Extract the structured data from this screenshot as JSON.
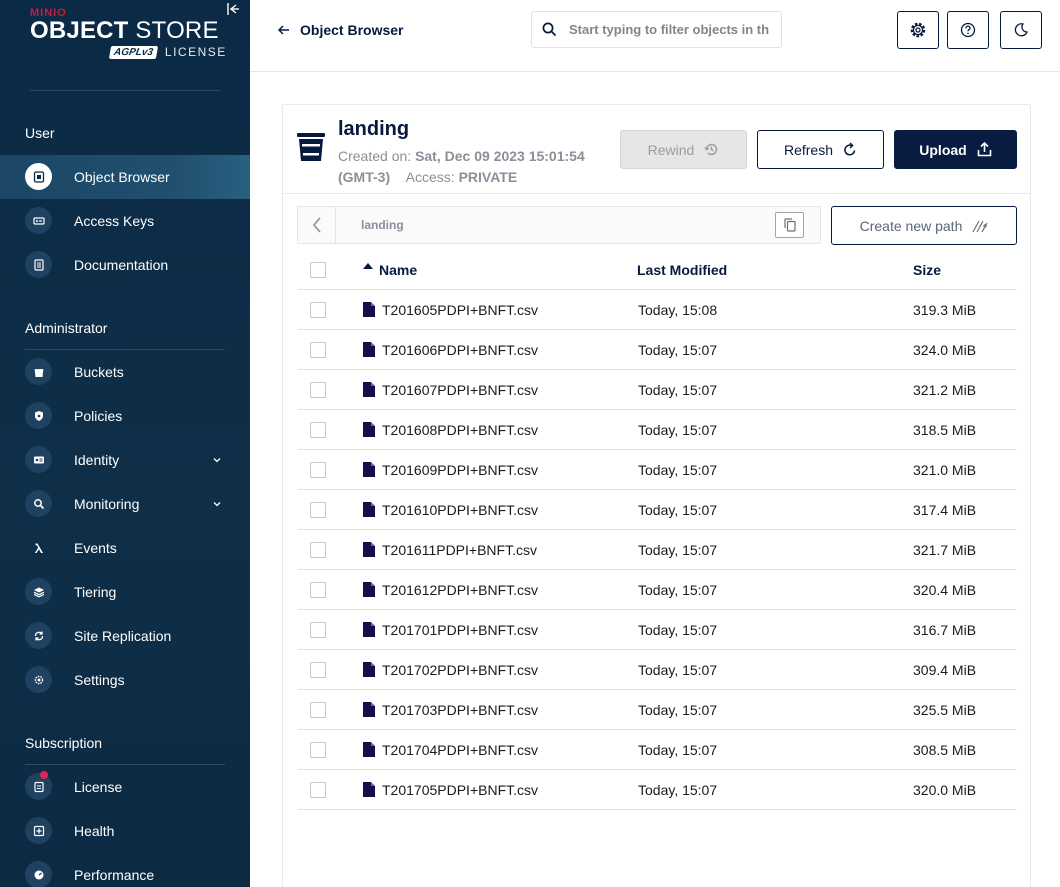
{
  "sidebar": {
    "logo": {
      "brand": "MINIO",
      "title_bold": "OBJECT",
      "title_rest": " STORE",
      "agpl": "AGPLv3",
      "license": "LICENSE"
    },
    "sections": [
      {
        "title": "User"
      },
      {
        "title": "Administrator"
      },
      {
        "title": "Subscription"
      }
    ],
    "items": [
      {
        "label": "Object Browser",
        "icon": "object-browser-icon"
      },
      {
        "label": "Access Keys",
        "icon": "key-icon"
      },
      {
        "label": "Documentation",
        "icon": "document-icon"
      },
      {
        "label": "Buckets",
        "icon": "bucket-icon"
      },
      {
        "label": "Policies",
        "icon": "shield-icon"
      },
      {
        "label": "Identity",
        "icon": "identity-icon"
      },
      {
        "label": "Monitoring",
        "icon": "magnifier-icon"
      },
      {
        "label": "Events",
        "icon": "lambda-icon"
      },
      {
        "label": "Tiering",
        "icon": "layers-icon"
      },
      {
        "label": "Site Replication",
        "icon": "sync-icon"
      },
      {
        "label": "Settings",
        "icon": "gear-icon"
      },
      {
        "label": "License",
        "icon": "license-icon"
      },
      {
        "label": "Health",
        "icon": "health-icon"
      },
      {
        "label": "Performance",
        "icon": "performance-icon"
      }
    ]
  },
  "header": {
    "back_label": "Object Browser",
    "search_placeholder": "Start typing to filter objects in the bucket"
  },
  "bucket": {
    "name": "landing",
    "created_label": "Created on:",
    "created_value": "Sat, Dec 09 2023 15:01:54 (GMT-3)",
    "access_label": "Access:",
    "access_value": "PRIVATE"
  },
  "actions": {
    "rewind": "Rewind",
    "refresh": "Refresh",
    "upload": "Upload",
    "create_path": "Create new path"
  },
  "breadcrumb": {
    "path": "landing"
  },
  "table": {
    "columns": {
      "name": "Name",
      "modified": "Last Modified",
      "size": "Size"
    },
    "rows": [
      {
        "name": "T201605PDPI+BNFT.csv",
        "modified": "Today, 15:08",
        "size": "319.3 MiB"
      },
      {
        "name": "T201606PDPI+BNFT.csv",
        "modified": "Today, 15:07",
        "size": "324.0 MiB"
      },
      {
        "name": "T201607PDPI+BNFT.csv",
        "modified": "Today, 15:07",
        "size": "321.2 MiB"
      },
      {
        "name": "T201608PDPI+BNFT.csv",
        "modified": "Today, 15:07",
        "size": "318.5 MiB"
      },
      {
        "name": "T201609PDPI+BNFT.csv",
        "modified": "Today, 15:07",
        "size": "321.0 MiB"
      },
      {
        "name": "T201610PDPI+BNFT.csv",
        "modified": "Today, 15:07",
        "size": "317.4 MiB"
      },
      {
        "name": "T201611PDPI+BNFT.csv",
        "modified": "Today, 15:07",
        "size": "321.7 MiB"
      },
      {
        "name": "T201612PDPI+BNFT.csv",
        "modified": "Today, 15:07",
        "size": "320.4 MiB"
      },
      {
        "name": "T201701PDPI+BNFT.csv",
        "modified": "Today, 15:07",
        "size": "316.7 MiB"
      },
      {
        "name": "T201702PDPI+BNFT.csv",
        "modified": "Today, 15:07",
        "size": "309.4 MiB"
      },
      {
        "name": "T201703PDPI+BNFT.csv",
        "modified": "Today, 15:07",
        "size": "325.5 MiB"
      },
      {
        "name": "T201704PDPI+BNFT.csv",
        "modified": "Today, 15:07",
        "size": "308.5 MiB"
      },
      {
        "name": "T201705PDPI+BNFT.csv",
        "modified": "Today, 15:07",
        "size": "320.0 MiB"
      }
    ]
  },
  "colors": {
    "sidebar_bg": "#0b2a45",
    "primary": "#081c42",
    "brand_red": "#c51c3f",
    "file_icon": "#1a0b4a"
  }
}
